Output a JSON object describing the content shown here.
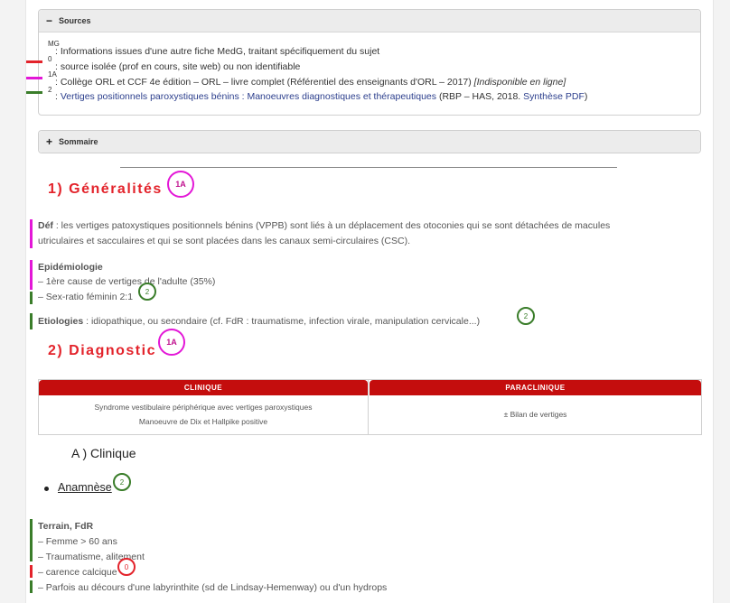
{
  "sources": {
    "title": "Sources",
    "toggle": "−",
    "levels": {
      "mg": "MG",
      "l0": "0",
      "l1a": "1A",
      "l2": "2"
    },
    "items": {
      "mg": ": Informations issues d'une autre fiche MedG, traitant spécifiquement du sujet",
      "l0": ": source isolée (prof en cours, site web) ou non identifiable",
      "l1a": ": Collège ORL et CCF 4e édition – ORL – livre complet (Référentiel des enseignants d'ORL – 2017)",
      "l1a_note": "[Indisponible en ligne]",
      "l2_prefix": ":",
      "l2_link": "Vertiges positionnels paroxystiques bénins : Manoeuvres diagnostiques et thérapeutiques",
      "l2_mid": "(RBP – HAS, 2018.",
      "l2_link2": "Synthèse PDF",
      "l2_end": ")"
    }
  },
  "sommaire": {
    "title": "Sommaire",
    "toggle": "+"
  },
  "section1": {
    "title": "1) Généralités",
    "badge": "1A",
    "def_label": "Déf",
    "def_line1": ": les vertiges patoxystiques positionnels bénins (VPPB) sont liés à un déplacement des otoconies qui se sont détachées de macules",
    "def_line2": "utriculaires et sacculaires et qui se sont placées dans les canaux semi-circulaires (CSC).",
    "epi_label": "Epidémiologie",
    "epi_1": "– 1ère cause de vertiges de l'adulte (35%)",
    "epi_2": "– Sex-ratio féminin 2:1",
    "epi_badge": "2",
    "etio_label": "Etiologies",
    "etio_text": ": idiopathique, ou secondaire (cf. FdR : traumatisme, infection virale, manipulation cervicale...)",
    "etio_badge": "2"
  },
  "section2": {
    "title": "2) Diagnostic",
    "badge": "1A",
    "table": {
      "col1": "CLINIQUE",
      "col2": "PARACLINIQUE",
      "c1_line1": "Syndrome vestibulaire périphérique avec vertiges paroxystiques",
      "c1_line2": "Manoeuvre de Dix et Hallpike positive",
      "c2_line1": "± Bilan de vertiges"
    },
    "sub": "A ) Clinique",
    "bullet": "Anamnèse",
    "bullet_badge": "2",
    "terrain_label": "Terrain, FdR",
    "t1": "– Femme > 60 ans",
    "t2": "– Traumatisme, alitement",
    "t3": "– carence calcique",
    "t3_badge": "0",
    "t4": "– Parfois au décours d'une labyrinthite (sd de Lindsay-Hemenway) ou d'un hydrops"
  },
  "colors": {
    "red": "#e3232b",
    "magenta": "#e317d7",
    "green": "#3a7d2a",
    "header_red": "#c40d0d"
  }
}
